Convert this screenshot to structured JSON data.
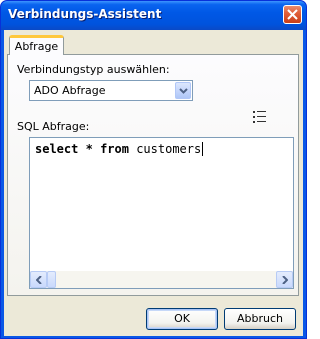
{
  "window": {
    "title": "Verbindungs-Assistent"
  },
  "tabs": [
    {
      "label": "Abfrage",
      "active": true
    }
  ],
  "connection_type": {
    "label": "Verbindungstyp auswählen:",
    "selected_value": "ADO Abfrage"
  },
  "sql": {
    "label": "SQL Abfrage:",
    "query": "select * from customers",
    "tokens": [
      {
        "text": "select",
        "keyword": true
      },
      {
        "text": " ",
        "keyword": false
      },
      {
        "text": "*",
        "keyword": true
      },
      {
        "text": " ",
        "keyword": false
      },
      {
        "text": "from",
        "keyword": true
      },
      {
        "text": " customers",
        "keyword": false
      }
    ]
  },
  "buttons": {
    "ok_label": "OK",
    "cancel_label": "Abbruch"
  },
  "colors": {
    "titlebar": "#0058e6",
    "tab_accent": "#ffc83c",
    "dialog_background": "#ece9d8",
    "control_border": "#7f9db9"
  },
  "icons": {
    "close": "close-icon",
    "dropdown": "chevron-down-icon",
    "list": "list-icon",
    "scroll_left": "arrow-left-icon",
    "scroll_right": "arrow-right-icon"
  }
}
